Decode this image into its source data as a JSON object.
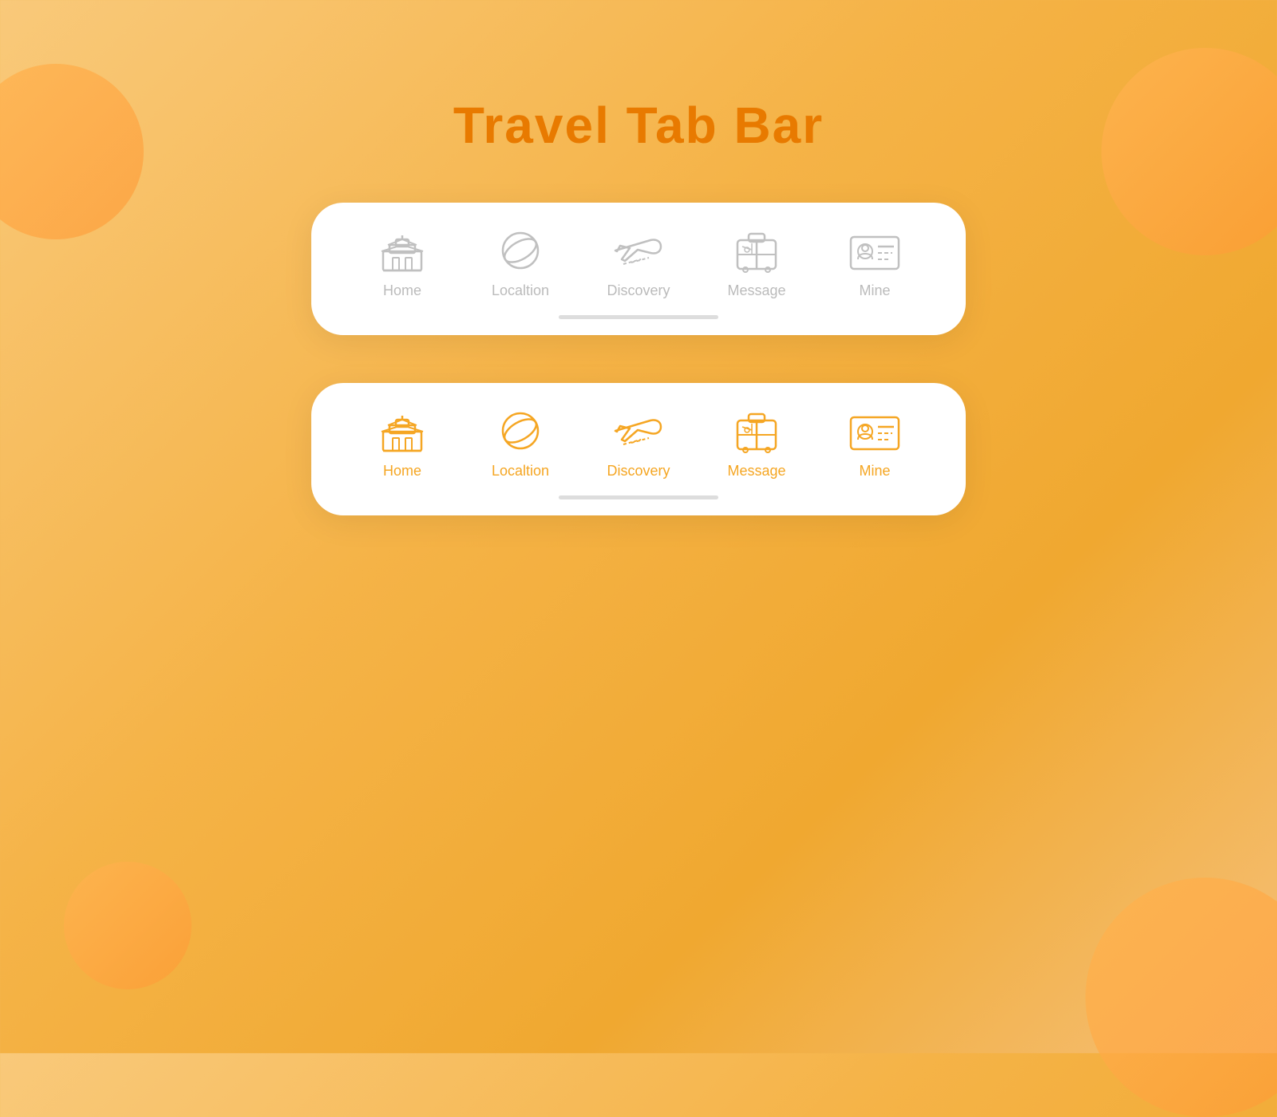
{
  "page": {
    "title": "Travel Tab Bar",
    "background": {
      "gradient_start": "#f9c97a",
      "gradient_end": "#f0a830"
    }
  },
  "tab_bars": [
    {
      "id": "inactive",
      "style": "inactive",
      "items": [
        {
          "id": "home",
          "label": "Home",
          "icon": "temple-icon",
          "active": false
        },
        {
          "id": "location",
          "label": "Localtion",
          "icon": "planet-icon",
          "active": false
        },
        {
          "id": "discovery",
          "label": "Discovery",
          "icon": "plane-icon",
          "active": false
        },
        {
          "id": "message",
          "label": "Message",
          "icon": "luggage-icon",
          "active": false
        },
        {
          "id": "mine",
          "label": "Mine",
          "icon": "id-card-icon",
          "active": false
        }
      ]
    },
    {
      "id": "active",
      "style": "active",
      "items": [
        {
          "id": "home",
          "label": "Home",
          "icon": "temple-icon",
          "active": true
        },
        {
          "id": "location",
          "label": "Localtion",
          "icon": "planet-icon",
          "active": true
        },
        {
          "id": "discovery",
          "label": "Discovery",
          "icon": "plane-icon",
          "active": true
        },
        {
          "id": "message",
          "label": "Message",
          "icon": "luggage-icon",
          "active": true
        },
        {
          "id": "mine",
          "label": "Mine",
          "icon": "id-card-icon",
          "active": true
        }
      ]
    }
  ],
  "colors": {
    "active": "#f5a623",
    "inactive": "#c0c0c0",
    "title": "#e87a00"
  }
}
